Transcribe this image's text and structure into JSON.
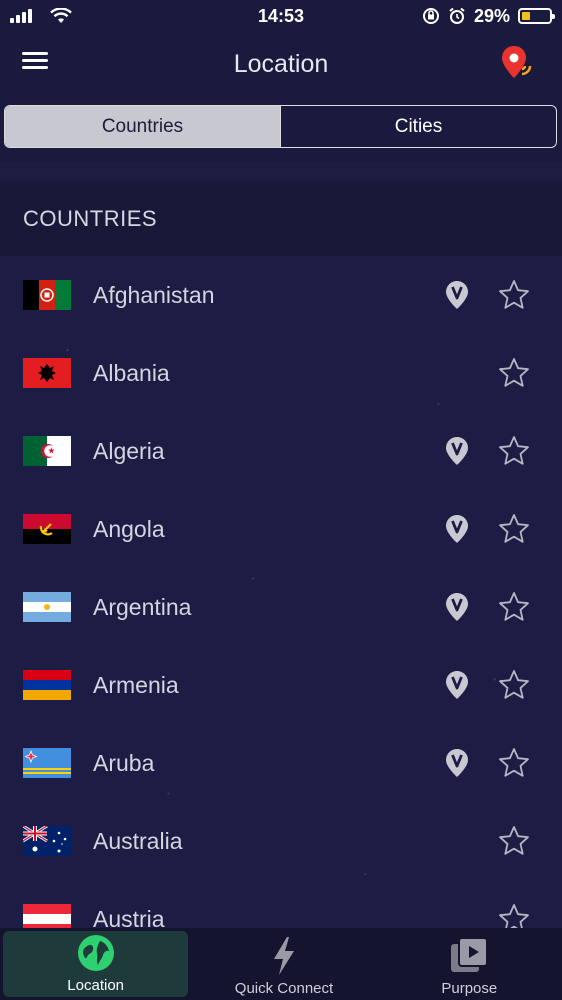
{
  "status_bar": {
    "time": "14:53",
    "battery_pct": "29%",
    "battery_level": 0.29
  },
  "header": {
    "title": "Location"
  },
  "segments": {
    "countries": "Countries",
    "cities": "Cities"
  },
  "section": {
    "title": "COUNTRIES"
  },
  "countries": [
    {
      "name": "Afghanistan",
      "flag": "afghanistan",
      "has_v": true
    },
    {
      "name": "Albania",
      "flag": "albania",
      "has_v": false
    },
    {
      "name": "Algeria",
      "flag": "algeria",
      "has_v": true
    },
    {
      "name": "Angola",
      "flag": "angola",
      "has_v": true
    },
    {
      "name": "Argentina",
      "flag": "argentina",
      "has_v": true
    },
    {
      "name": "Armenia",
      "flag": "armenia",
      "has_v": true
    },
    {
      "name": "Aruba",
      "flag": "aruba",
      "has_v": true
    },
    {
      "name": "Australia",
      "flag": "australia",
      "has_v": false
    },
    {
      "name": "Austria",
      "flag": "austria",
      "has_v": false
    }
  ],
  "tabs": [
    {
      "label": "Location",
      "icon": "globe-icon",
      "active": true
    },
    {
      "label": "Quick Connect",
      "icon": "lightning-icon",
      "active": false
    },
    {
      "label": "Purpose",
      "icon": "video-icon",
      "active": false
    }
  ],
  "colors": {
    "accent": "#2fd06f",
    "background": "#1a1a3e",
    "pin": "#e8332e",
    "battery": "#f2c01c"
  }
}
